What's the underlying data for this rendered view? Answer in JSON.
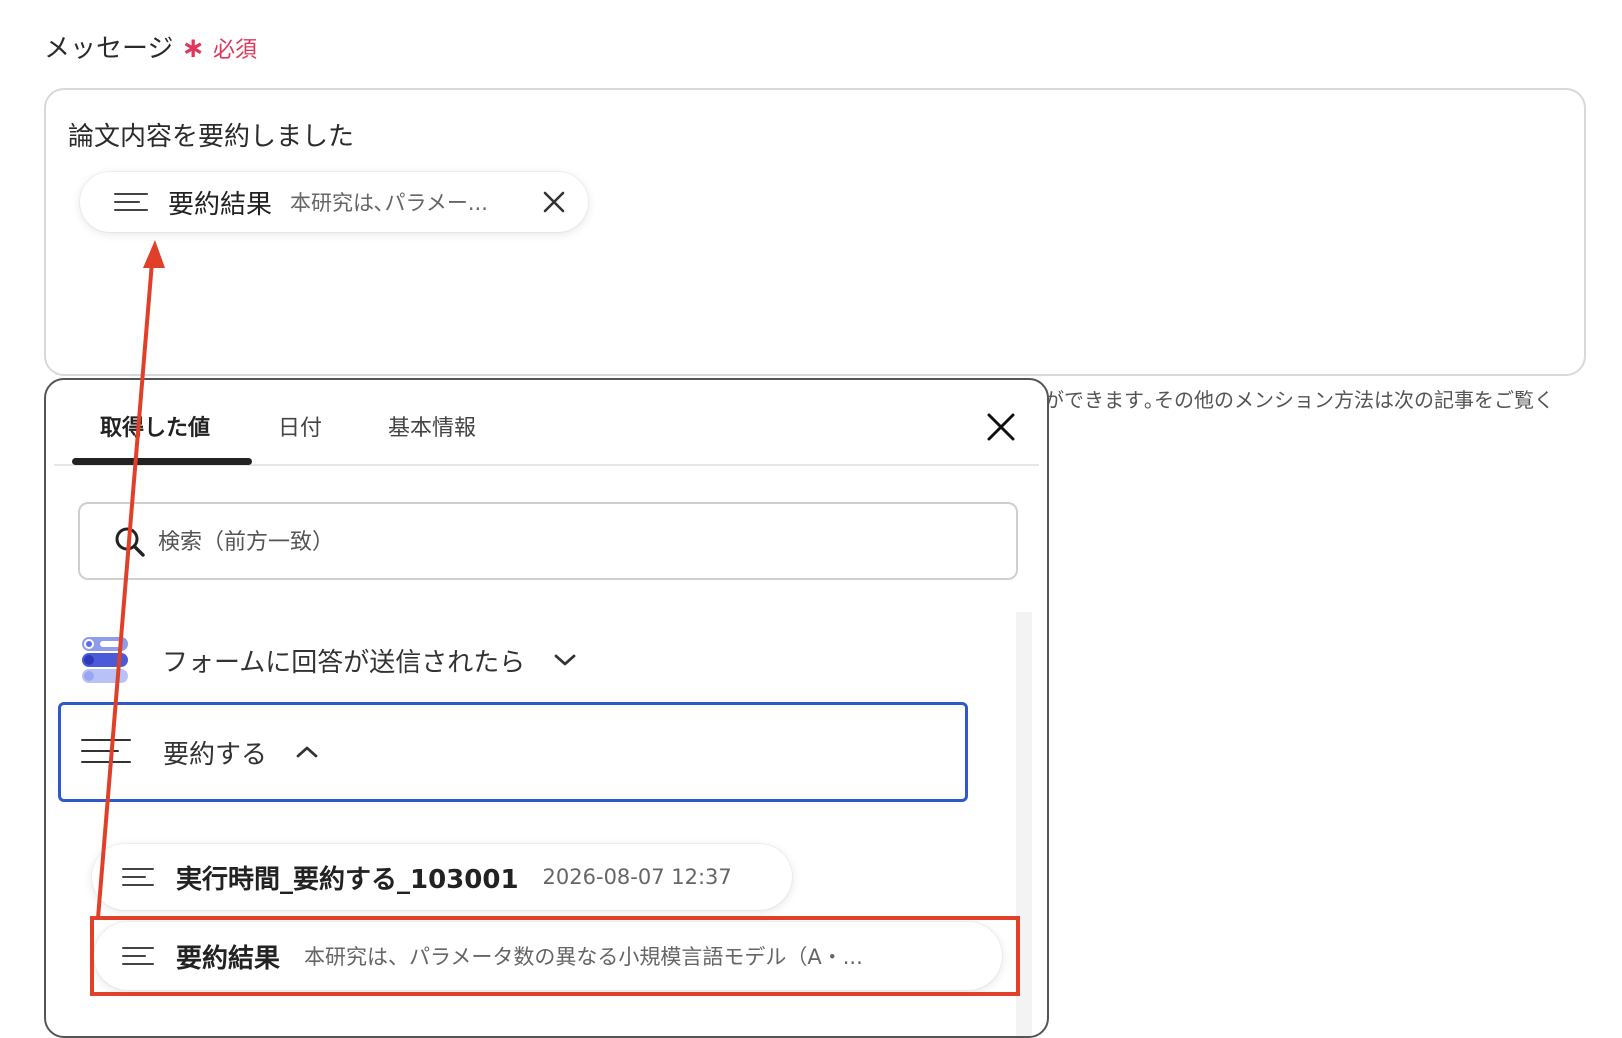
{
  "field": {
    "label": "メッセージ",
    "required_star": "∗",
    "required_text": "必須"
  },
  "message": {
    "text": "論文内容を要約しました",
    "chip": {
      "name": "要約結果",
      "value": "本研究は､パラメー..."
    }
  },
  "hint": "ができます｡その他のメンション方法は次の記事をご覧く",
  "popup": {
    "tabs": [
      {
        "label": "取得した値"
      },
      {
        "label": "日付"
      },
      {
        "label": "基本情報"
      }
    ],
    "search_placeholder": "検索（前方一致）",
    "groups": [
      {
        "label": "フォームに回答が送信されたら",
        "icon": "form-app-icon",
        "expanded": false
      },
      {
        "label": "要約する",
        "icon": "lines-icon",
        "expanded": true
      }
    ],
    "items": [
      {
        "name": "実行時間_要約する_103001",
        "value": "2026-08-07 12:37"
      },
      {
        "name": "要約結果",
        "value": "本研究は、パラメータ数の異なる小規模言語モデル（A・..."
      }
    ]
  },
  "colors": {
    "required": "#e0365a",
    "selection_border": "#2f59c8",
    "annotation": "#e0402a"
  }
}
